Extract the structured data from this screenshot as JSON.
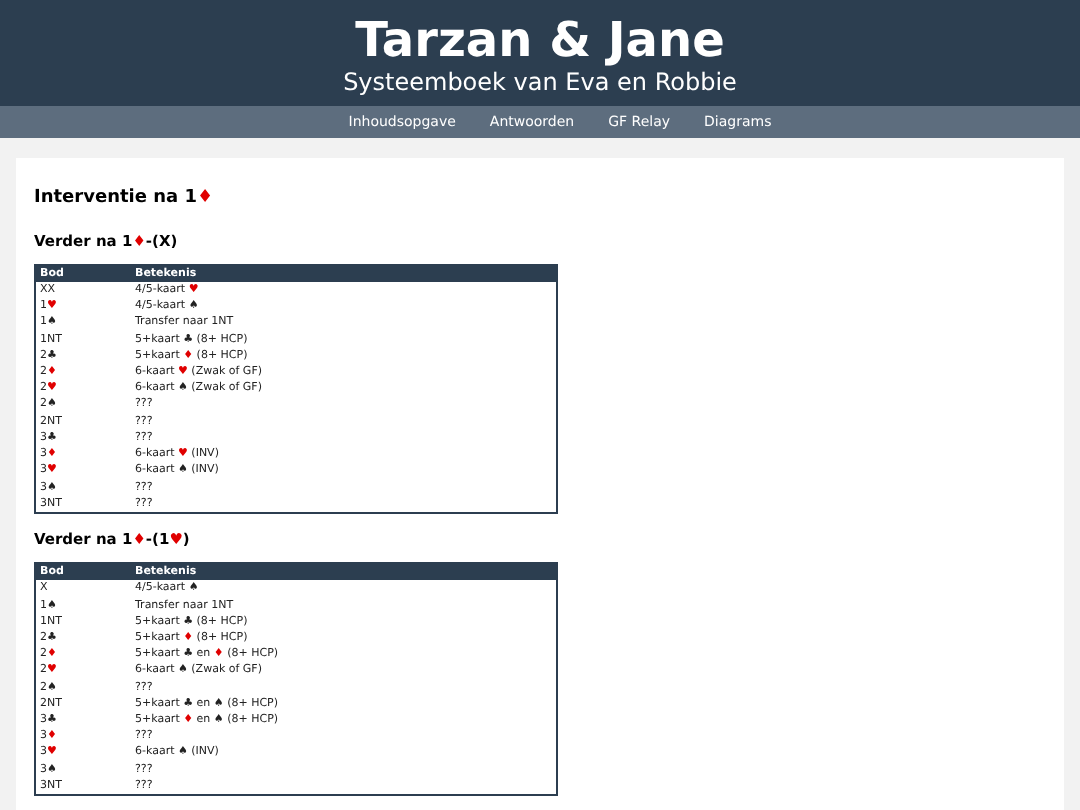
{
  "header": {
    "title": "Tarzan & Jane",
    "subtitle": "Systeemboek van Eva en Robbie"
  },
  "nav": [
    "Inhoudsopgave",
    "Antwoorden",
    "GF Relay",
    "Diagrams"
  ],
  "heading": [
    {
      "text": "Interventie na 1"
    },
    {
      "text": "♦",
      "color": "#e00000"
    }
  ],
  "sections": [
    {
      "title": [
        {
          "text": "Verder na 1"
        },
        {
          "text": "♦",
          "color": "#e00000"
        },
        {
          "text": "-(X)"
        }
      ],
      "columns": [
        "Bod",
        "Betekenis"
      ],
      "rows": [
        [
          [
            {
              "text": "XX"
            }
          ],
          [
            {
              "text": "4/5-kaart "
            },
            {
              "text": "♥",
              "color": "#e00000"
            }
          ]
        ],
        [
          [
            {
              "text": "1"
            },
            {
              "text": "♥",
              "color": "#e00000"
            }
          ],
          [
            {
              "text": "4/5-kaart ♠"
            }
          ]
        ],
        [
          [
            {
              "text": "1♠"
            }
          ],
          [
            {
              "text": "Transfer naar 1NT"
            }
          ]
        ],
        [
          [
            {
              "text": "1NT"
            }
          ],
          [
            {
              "text": "5+kaart ♣ (8+ HCP)"
            }
          ]
        ],
        [
          [
            {
              "text": "2♣"
            }
          ],
          [
            {
              "text": "5+kaart "
            },
            {
              "text": "♦",
              "color": "#e00000"
            },
            {
              "text": " (8+ HCP)"
            }
          ]
        ],
        [
          [
            {
              "text": "2"
            },
            {
              "text": "♦",
              "color": "#e00000"
            }
          ],
          [
            {
              "text": "6-kaart "
            },
            {
              "text": "♥",
              "color": "#e00000"
            },
            {
              "text": " (Zwak of GF)"
            }
          ]
        ],
        [
          [
            {
              "text": "2"
            },
            {
              "text": "♥",
              "color": "#e00000"
            }
          ],
          [
            {
              "text": "6-kaart ♠ (Zwak of GF)"
            }
          ]
        ],
        [
          [
            {
              "text": "2♠"
            }
          ],
          [
            {
              "text": "???"
            }
          ]
        ],
        [
          [
            {
              "text": "2NT"
            }
          ],
          [
            {
              "text": "???"
            }
          ]
        ],
        [
          [
            {
              "text": "3♣"
            }
          ],
          [
            {
              "text": "???"
            }
          ]
        ],
        [
          [
            {
              "text": "3"
            },
            {
              "text": "♦",
              "color": "#e00000"
            }
          ],
          [
            {
              "text": "6-kaart "
            },
            {
              "text": "♥",
              "color": "#e00000"
            },
            {
              "text": " (INV)"
            }
          ]
        ],
        [
          [
            {
              "text": "3"
            },
            {
              "text": "♥",
              "color": "#e00000"
            }
          ],
          [
            {
              "text": "6-kaart ♠ (INV)"
            }
          ]
        ],
        [
          [
            {
              "text": "3♠"
            }
          ],
          [
            {
              "text": "???"
            }
          ]
        ],
        [
          [
            {
              "text": "3NT"
            }
          ],
          [
            {
              "text": "???"
            }
          ]
        ]
      ]
    },
    {
      "title": [
        {
          "text": "Verder na 1"
        },
        {
          "text": "♦",
          "color": "#e00000"
        },
        {
          "text": "-(1"
        },
        {
          "text": "♥",
          "color": "#e00000"
        },
        {
          "text": ")"
        }
      ],
      "columns": [
        "Bod",
        "Betekenis"
      ],
      "rows": [
        [
          [
            {
              "text": "X"
            }
          ],
          [
            {
              "text": "4/5-kaart ♠"
            }
          ]
        ],
        [
          [
            {
              "text": "1♠"
            }
          ],
          [
            {
              "text": "Transfer naar 1NT"
            }
          ]
        ],
        [
          [
            {
              "text": "1NT"
            }
          ],
          [
            {
              "text": "5+kaart ♣ (8+ HCP)"
            }
          ]
        ],
        [
          [
            {
              "text": "2♣"
            }
          ],
          [
            {
              "text": "5+kaart "
            },
            {
              "text": "♦",
              "color": "#e00000"
            },
            {
              "text": " (8+ HCP)"
            }
          ]
        ],
        [
          [
            {
              "text": "2"
            },
            {
              "text": "♦",
              "color": "#e00000"
            }
          ],
          [
            {
              "text": "5+kaart ♣ en "
            },
            {
              "text": "♦",
              "color": "#e00000"
            },
            {
              "text": " (8+ HCP)"
            }
          ]
        ],
        [
          [
            {
              "text": "2"
            },
            {
              "text": "♥",
              "color": "#e00000"
            }
          ],
          [
            {
              "text": "6-kaart ♠ (Zwak of GF)"
            }
          ]
        ],
        [
          [
            {
              "text": "2♠"
            }
          ],
          [
            {
              "text": "???"
            }
          ]
        ],
        [
          [
            {
              "text": "2NT"
            }
          ],
          [
            {
              "text": "5+kaart ♣ en ♠ (8+ HCP)"
            }
          ]
        ],
        [
          [
            {
              "text": "3♣"
            }
          ],
          [
            {
              "text": "5+kaart "
            },
            {
              "text": "♦",
              "color": "#e00000"
            },
            {
              "text": " en ♠ (8+ HCP)"
            }
          ]
        ],
        [
          [
            {
              "text": "3"
            },
            {
              "text": "♦",
              "color": "#e00000"
            }
          ],
          [
            {
              "text": "???"
            }
          ]
        ],
        [
          [
            {
              "text": "3"
            },
            {
              "text": "♥",
              "color": "#e00000"
            }
          ],
          [
            {
              "text": "6-kaart ♠ (INV)"
            }
          ]
        ],
        [
          [
            {
              "text": "3♠"
            }
          ],
          [
            {
              "text": "???"
            }
          ]
        ],
        [
          [
            {
              "text": "3NT"
            }
          ],
          [
            {
              "text": "???"
            }
          ]
        ]
      ]
    }
  ]
}
